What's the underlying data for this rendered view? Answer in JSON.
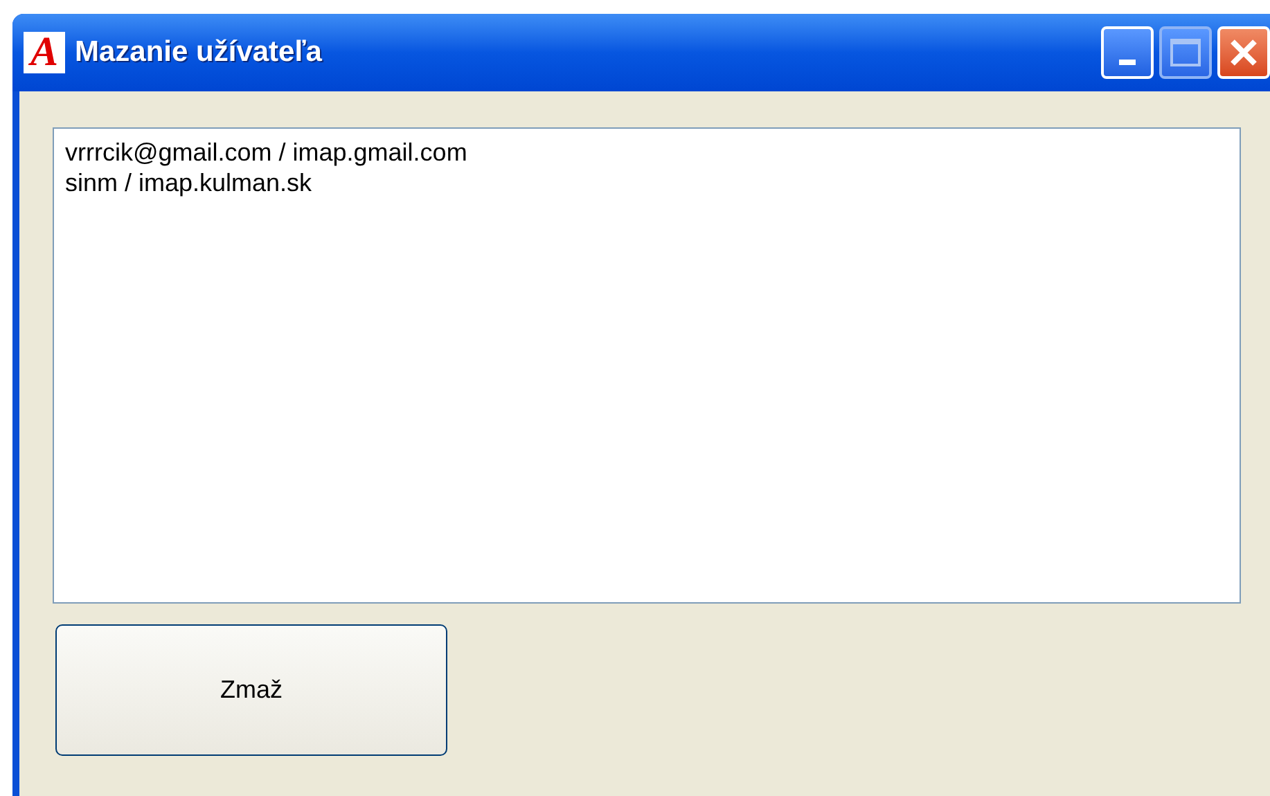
{
  "window": {
    "logo_letter": "A",
    "title": "Mazanie užívateľa"
  },
  "accounts": [
    {
      "text": "vrrrcik@gmail.com / imap.gmail.com"
    },
    {
      "text": "sinm / imap.kulman.sk"
    }
  ],
  "delete_button": {
    "label": "Zmaž"
  }
}
